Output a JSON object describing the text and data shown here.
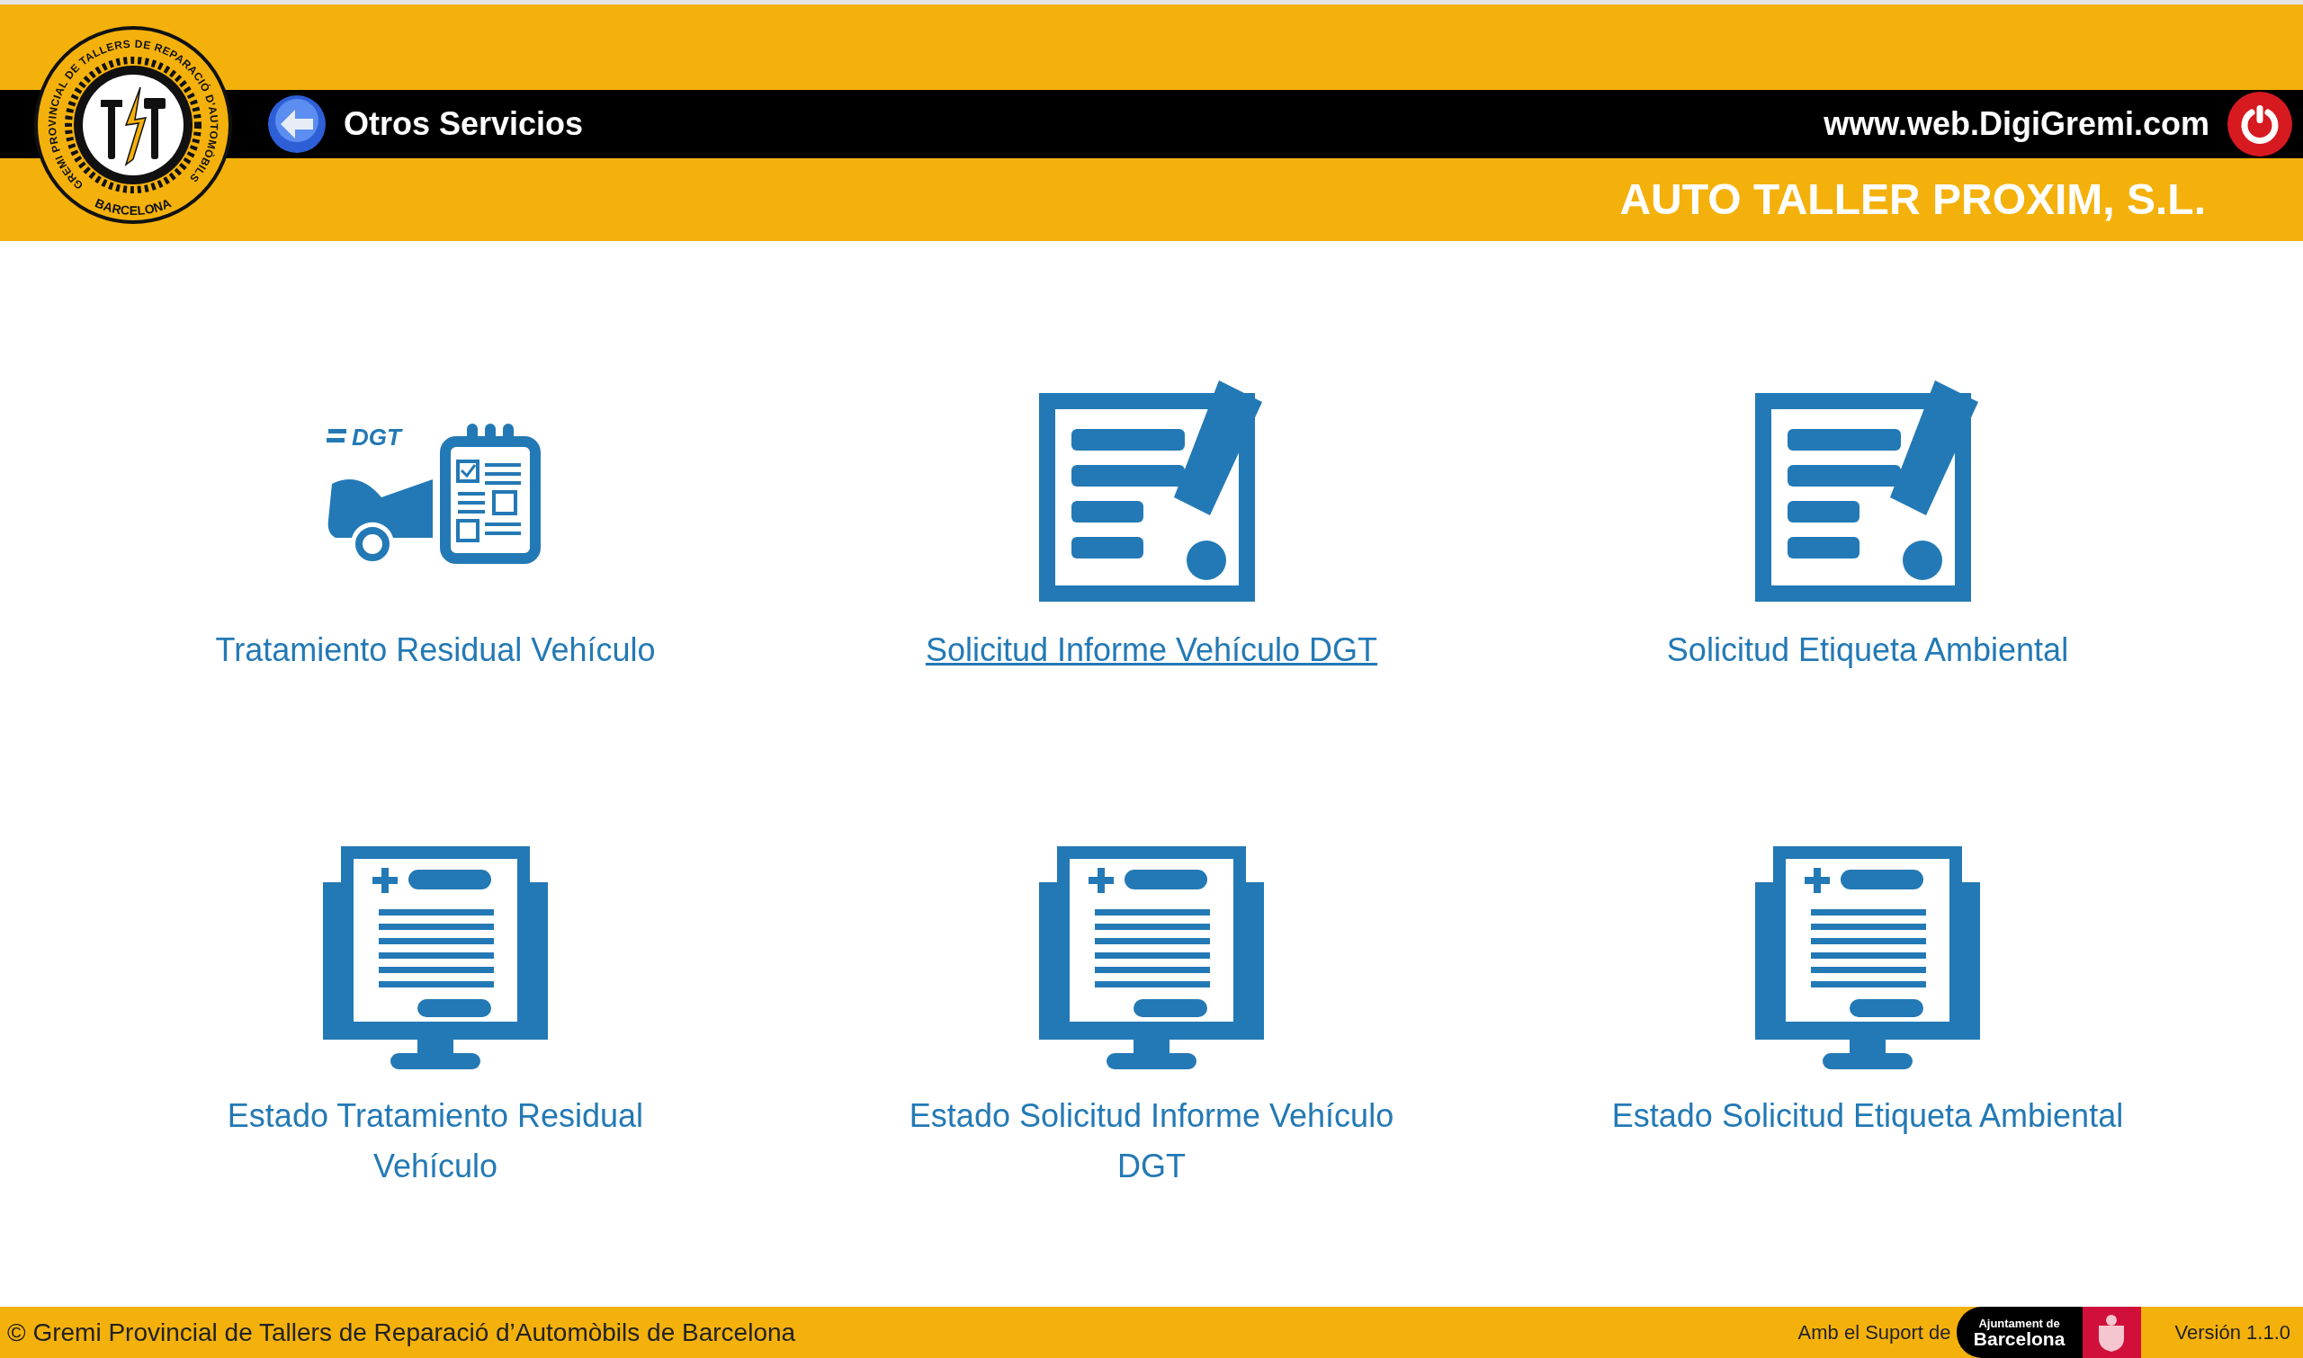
{
  "header": {
    "logo": {
      "ring_text": "GREMI PROVINCIAL DE TALLERS DE REPARACIÓ D'AUTOMÒBILS",
      "bottom_text": "BARCELONA"
    },
    "back_label": "Otros Servicios",
    "website": "www.web.DigiGremi.com",
    "company": "AUTO TALLER PROXIM, S.L."
  },
  "services": [
    {
      "kind": "dgt-car",
      "label": "Tratamiento Residual Vehículo",
      "badge": "DGT",
      "hovered": false
    },
    {
      "kind": "form-edit",
      "label": "Solicitud Informe Vehículo DGT",
      "hovered": true
    },
    {
      "kind": "form-edit",
      "label": "Solicitud Etiqueta Ambiental",
      "hovered": false
    },
    {
      "kind": "monitor-doc",
      "label": "Estado Tratamiento Residual Vehículo",
      "hovered": false
    },
    {
      "kind": "monitor-doc",
      "label": "Estado Solicitud Informe Vehículo DGT",
      "hovered": false
    },
    {
      "kind": "monitor-doc",
      "label": "Estado Solicitud Etiqueta Ambiental",
      "hovered": false
    }
  ],
  "footer": {
    "copyright": "© Gremi Provincial de Tallers de Reparació d’Automòbils de Barcelona",
    "support": "Amb el Suport de",
    "sponsor_small": "Ajuntament de",
    "sponsor_big": "Barcelona",
    "version": "Versión 1.1.0"
  }
}
